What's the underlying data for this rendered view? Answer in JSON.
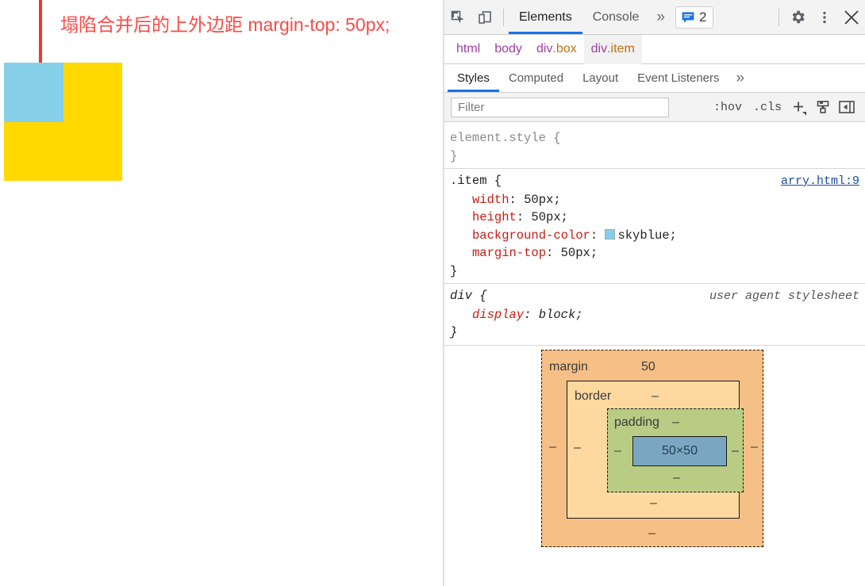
{
  "page": {
    "heading": "塌陷合并后的上外边距 margin-top: 50px;",
    "heading_color": "#fb4a46",
    "marker_color": "#f5352f",
    "outer_box_color": "#ffd900",
    "inner_box_color": "#85cfe8"
  },
  "devtools": {
    "toolbar": {
      "inspect_icon": "inspect-element-icon",
      "device_icon": "device-toolbar-icon",
      "tabs": [
        {
          "label": "Elements",
          "active": true
        },
        {
          "label": "Console",
          "active": false
        }
      ],
      "more_tabs": "»",
      "messages_count": "2",
      "messages_icon": "message-bubble-icon",
      "settings_icon": "gear-icon",
      "menu_icon": "three-dot-menu-icon",
      "close_icon": "close-icon"
    },
    "breadcrumb": [
      {
        "tag": "html",
        "cls": "",
        "selected": false
      },
      {
        "tag": "body",
        "cls": "",
        "selected": false
      },
      {
        "tag": "div",
        "cls": ".box",
        "selected": false
      },
      {
        "tag": "div",
        "cls": ".item",
        "selected": true
      }
    ],
    "subtabs": [
      {
        "label": "Styles",
        "active": true
      },
      {
        "label": "Computed",
        "active": false
      },
      {
        "label": "Layout",
        "active": false
      },
      {
        "label": "Event Listeners",
        "active": false
      }
    ],
    "subtabs_more": "»",
    "filter": {
      "placeholder": "Filter",
      "value": "",
      "hov_label": ":hov",
      "cls_label": ".cls",
      "new_rule_label": "+",
      "new_rule_icon": "plus-icon",
      "style_icon": "paint-brush-icon",
      "sidebar_toggle_icon": "panel-toggle-icon"
    },
    "rules": [
      {
        "selector": "element.style {",
        "selector_style": "gray",
        "close": "}",
        "source": "",
        "source_type": "none",
        "declarations": []
      },
      {
        "selector": ".item {",
        "selector_style": "dark",
        "close": "}",
        "source": "arry.html:9",
        "source_type": "link",
        "declarations": [
          {
            "prop": "width",
            "value": "50px;",
            "swatch": ""
          },
          {
            "prop": "height",
            "value": "50px;",
            "swatch": ""
          },
          {
            "prop": "background-color",
            "value": "skyblue;",
            "swatch": "#87ceeb"
          },
          {
            "prop": "margin-top",
            "value": "50px;",
            "swatch": ""
          }
        ]
      },
      {
        "selector": "div {",
        "selector_style": "dark",
        "close": "}",
        "source": "user agent stylesheet",
        "source_type": "note",
        "italic": true,
        "declarations": [
          {
            "prop": "display",
            "value": "block;",
            "swatch": ""
          }
        ]
      }
    ],
    "box_model": {
      "margin_label": "margin",
      "border_label": "border",
      "padding_label": "padding",
      "content_size": "50×50",
      "margin": {
        "top": "50",
        "right": "–",
        "bottom": "–",
        "left": "–"
      },
      "border": {
        "top": "–",
        "right": "–",
        "bottom": "–",
        "left": "–"
      },
      "padding": {
        "top": "–",
        "right": "–",
        "bottom": "–",
        "left": "–"
      },
      "colors": {
        "margin": "#f5bf85",
        "border": "#fdd9a0",
        "padding": "#b8cc84",
        "content": "#7ba6c2"
      }
    }
  }
}
